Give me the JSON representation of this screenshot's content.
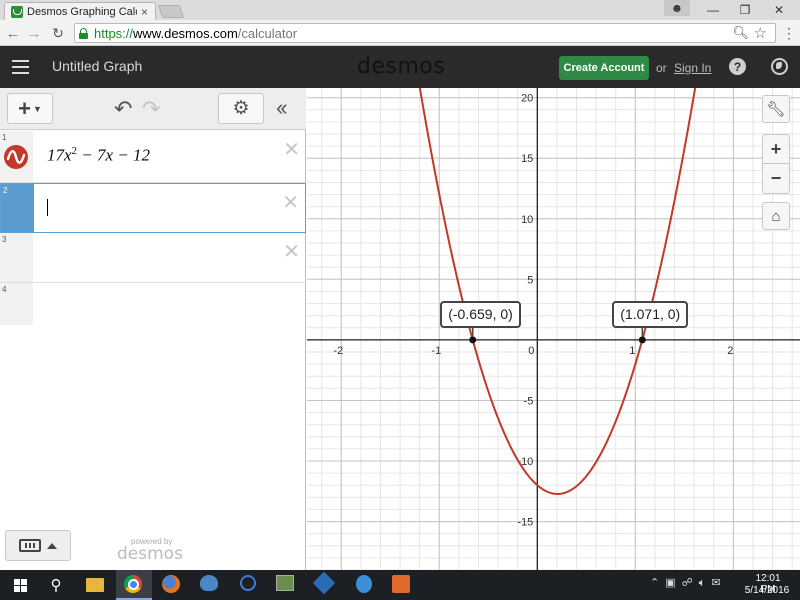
{
  "browser": {
    "tab_title": "Desmos Graphing Calcula",
    "tab_close": "×",
    "url_scheme": "https://",
    "url_host": "www.desmos.com",
    "url_path": "/calculator"
  },
  "header": {
    "graph_title": "Untitled Graph",
    "logo": "desmos",
    "create_account": "Create Account",
    "or_text": "or",
    "sign_in": "Sign In",
    "help": "?"
  },
  "expressions": {
    "rows": [
      {
        "number": "1",
        "base": "17",
        "variable": "x",
        "exponent": "2",
        "rest": " − 7x − 12"
      },
      {
        "number": "2"
      },
      {
        "number": "3"
      },
      {
        "number": "4"
      }
    ],
    "powered_by": "powered by",
    "powered_logo": "desmos"
  },
  "graph": {
    "curve_color": "#c0392b",
    "function": {
      "a": 17,
      "b": -7,
      "c": -12
    },
    "x_range": [
      -2.35,
      2.68
    ],
    "y_range": [
      -19.0,
      20.8
    ],
    "x_ticks": [
      "-2",
      "-1",
      "0",
      "1",
      "2"
    ],
    "y_ticks": [
      "20",
      "15",
      "10",
      "5",
      "-5",
      "-10",
      "-15"
    ],
    "points": [
      {
        "label": "(-0.659, 0)",
        "x": -0.659,
        "y": 0
      },
      {
        "label": "(1.071, 0)",
        "x": 1.071,
        "y": 0
      }
    ]
  },
  "taskbar": {
    "clock_time": "12:01 PM",
    "clock_date": "5/14/2016"
  }
}
